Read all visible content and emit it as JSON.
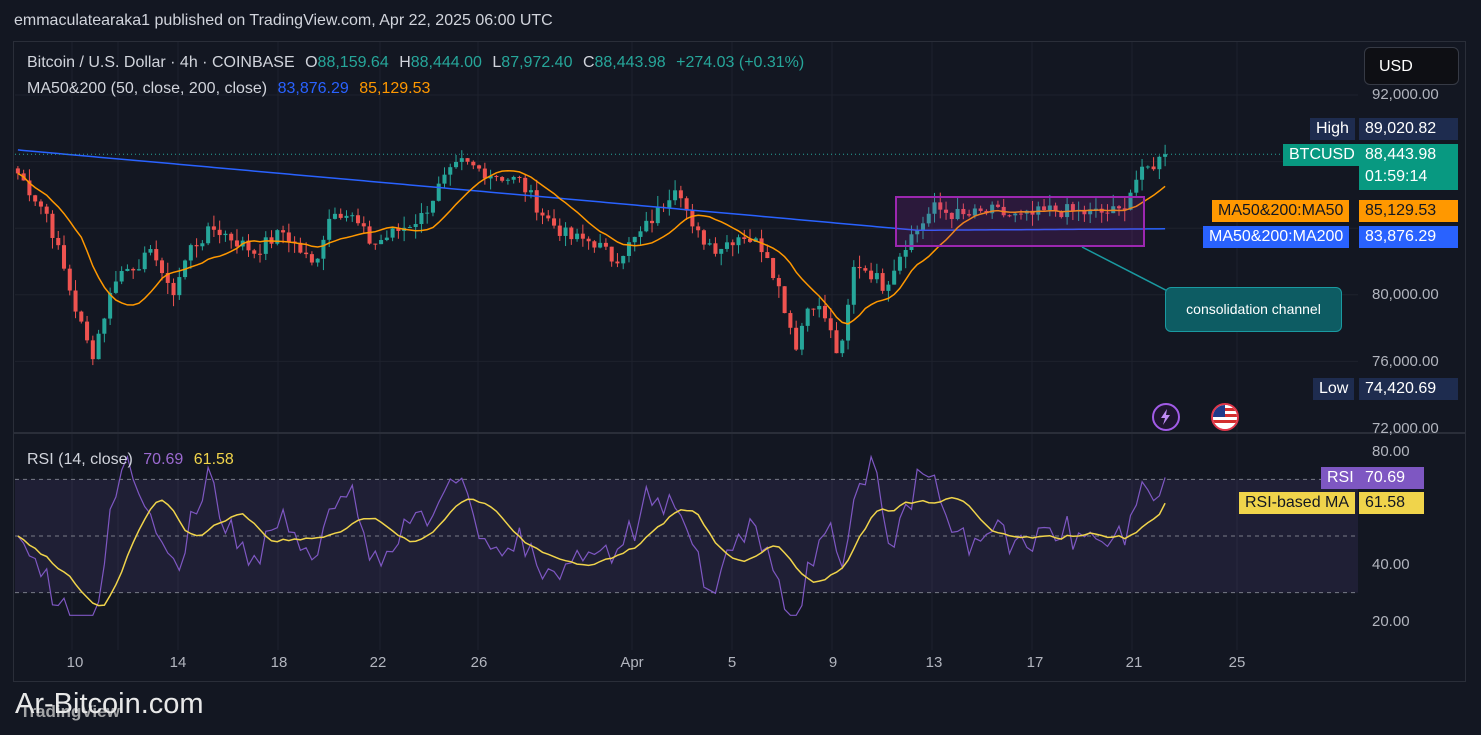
{
  "publisher_line": "emmaculatearaka1 published on TradingView.com, Apr 22, 2025 06:00 UTC",
  "legend": {
    "symbol": "Bitcoin / U.S. Dollar · 4h · COINBASE",
    "o_label": "O",
    "o_value": "88,159.64",
    "h_label": "H",
    "h_value": "88,444.00",
    "l_label": "L",
    "l_value": "87,972.40",
    "c_label": "C",
    "c_value": "88,443.98",
    "change": "+274.03 (+0.31%)",
    "ma_name": "MA50&200 (50, close, 200, close)",
    "ma50_value": "83,876.29",
    "ma200_value": "85,129.53",
    "rsi_name": "RSI (14, close)",
    "rsi_value": "70.69",
    "rsi_ma_value": "61.58"
  },
  "currency_button": "USD",
  "price_axis": [
    "92,000.00",
    "80,000.00",
    "76,000.00",
    "72,000.00"
  ],
  "rsi_axis": [
    "80.00",
    "40.00",
    "20.00"
  ],
  "time_axis": [
    "10",
    "14",
    "18",
    "22",
    "26",
    "Apr",
    "5",
    "9",
    "13",
    "17",
    "21",
    "25"
  ],
  "price_labels": {
    "high_label": "High",
    "high_value": "89,020.82",
    "btc_label": "BTCUSD",
    "btc_value": "88,443.98",
    "btc_countdown": "01:59:14",
    "ma50_label": "MA50&200:MA50",
    "ma50_value": "85,129.53",
    "ma200_label": "MA50&200:MA200",
    "ma200_value": "83,876.29",
    "low_label": "Low",
    "low_value": "74,420.69",
    "rsi_label": "RSI",
    "rsi_value": "70.69",
    "rsima_label": "RSI-based MA",
    "rsima_value": "61.58"
  },
  "annotation": "consolidation channel",
  "watermark": "Ar-Bitcoin.com",
  "watermark_tv": "TradingView",
  "colors": {
    "background": "#131722",
    "up": "#26a69a",
    "down": "#ef5350",
    "ma50": "#ff9800",
    "ma200": "#2962ff",
    "rsi": "#7e57c2",
    "rsi_ma": "#f0d44b",
    "channel": "#9c27b0"
  },
  "chart_data": {
    "type": "candlestick",
    "price_scale": {
      "min": 72000,
      "max": 92000
    },
    "rsi_scale": {
      "min": 20,
      "max": 80,
      "bands": [
        30,
        50,
        70
      ]
    },
    "series": [
      {
        "name": "BTCUSD",
        "anchors": [
          [
            0,
            87300
          ],
          [
            0.03,
            84800
          ],
          [
            0.06,
            78900
          ],
          [
            0.075,
            76300
          ],
          [
            0.1,
            81200
          ],
          [
            0.14,
            82500
          ],
          [
            0.155,
            79800
          ],
          [
            0.175,
            82800
          ],
          [
            0.2,
            84000
          ],
          [
            0.24,
            82600
          ],
          [
            0.27,
            83800
          ],
          [
            0.3,
            81700
          ],
          [
            0.32,
            85300
          ],
          [
            0.34,
            84600
          ],
          [
            0.36,
            83000
          ],
          [
            0.39,
            84000
          ],
          [
            0.41,
            84700
          ],
          [
            0.43,
            86700
          ],
          [
            0.45,
            87900
          ],
          [
            0.48,
            87300
          ],
          [
            0.51,
            86800
          ],
          [
            0.535,
            84700
          ],
          [
            0.56,
            83400
          ],
          [
            0.585,
            83200
          ],
          [
            0.605,
            82100
          ],
          [
            0.63,
            83500
          ],
          [
            0.65,
            85000
          ],
          [
            0.67,
            86900
          ],
          [
            0.685,
            83800
          ],
          [
            0.71,
            82800
          ],
          [
            0.735,
            83700
          ],
          [
            0.76,
            82700
          ],
          [
            0.775,
            80000
          ],
          [
            0.79,
            77000
          ],
          [
            0.805,
            79800
          ],
          [
            0.82,
            78600
          ],
          [
            0.835,
            76000
          ],
          [
            0.85,
            82000
          ],
          [
            0.865,
            81400
          ],
          [
            0.88,
            80500
          ],
          [
            0.9,
            83000
          ],
          [
            0.93,
            85200
          ],
          [
            0.96,
            84700
          ],
          [
            0.99,
            85000
          ],
          [
            1.02,
            84600
          ],
          [
            1.05,
            85100
          ],
          [
            1.09,
            84900
          ],
          [
            1.12,
            85000
          ],
          [
            1.135,
            86900
          ],
          [
            1.15,
            87700
          ],
          [
            1.165,
            88400
          ]
        ]
      },
      {
        "name": "MA50&200:MA50",
        "value": 85129.53
      },
      {
        "name": "MA50&200:MA200",
        "value": 83876.29
      },
      {
        "name": "RSI",
        "value": 70.69
      },
      {
        "name": "RSI-based MA",
        "value": 61.58
      }
    ],
    "high": 89020.82,
    "low": 74420.69,
    "last": 88443.98
  }
}
